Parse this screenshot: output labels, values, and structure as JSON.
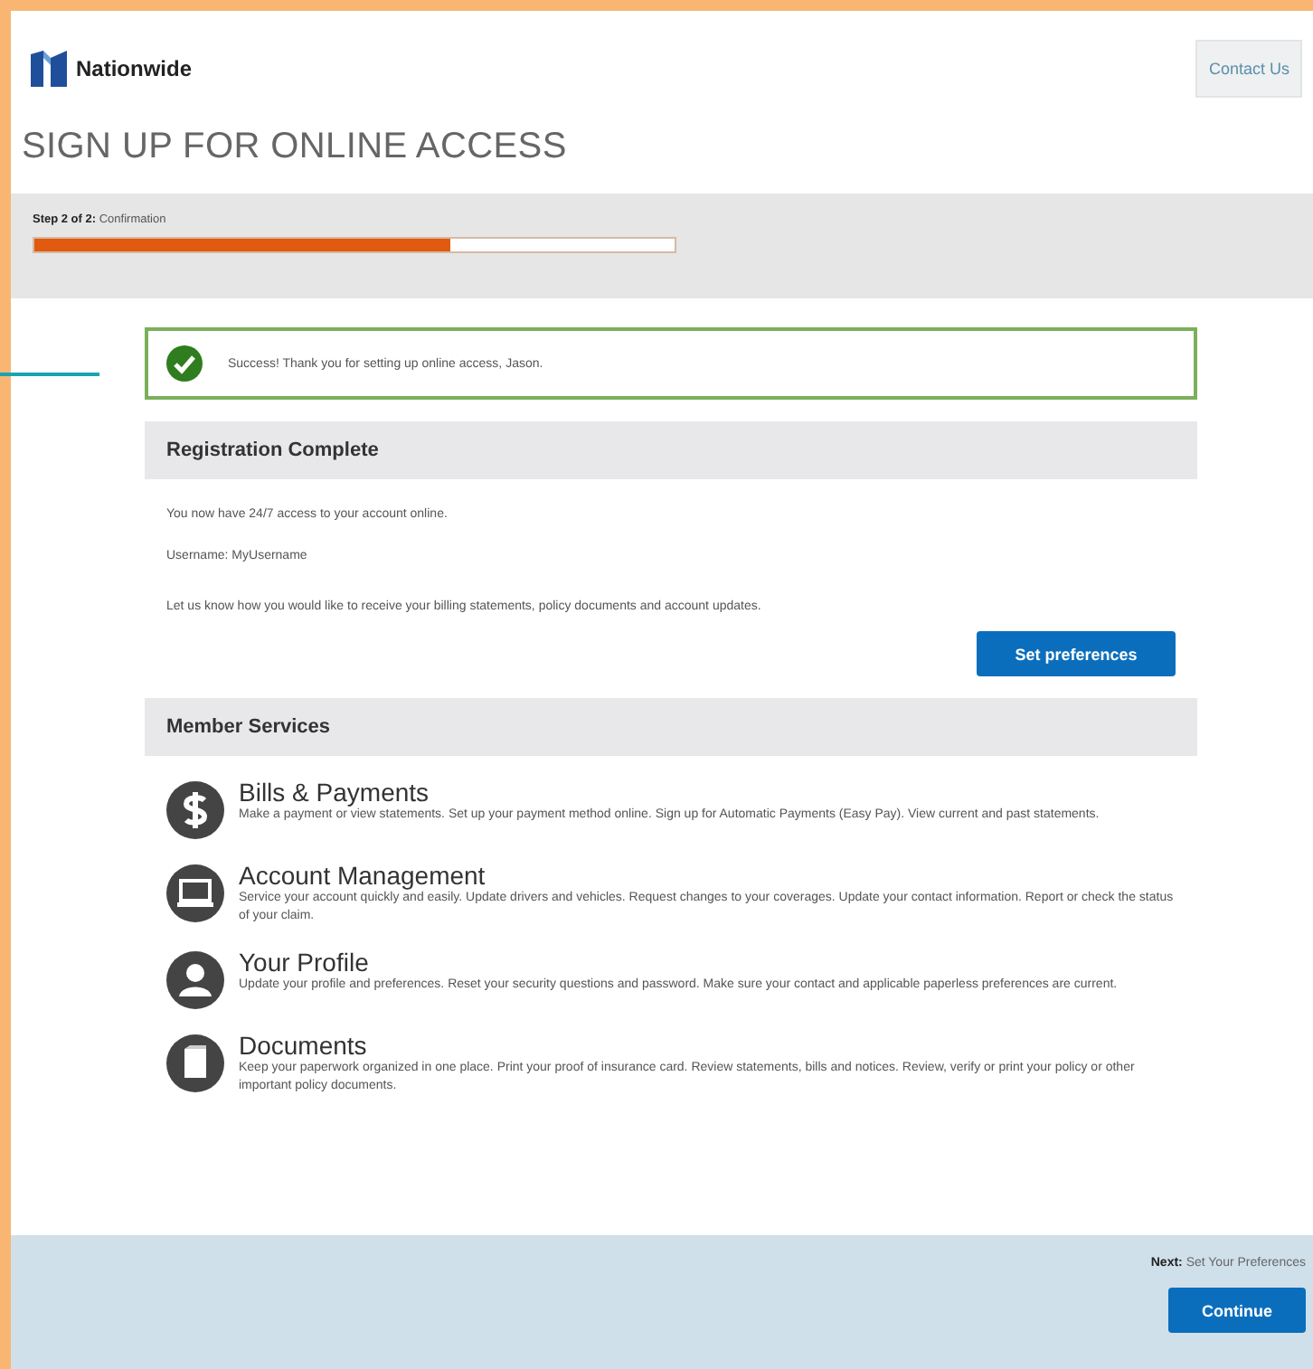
{
  "header": {
    "logo": "Nationwide",
    "contact_button": "Contact Us"
  },
  "page_title": "SIGN UP FOR ONLINE ACCESS",
  "progress": {
    "label": "**Step 2 of 2:** Confirmation",
    "level": 0.65
  },
  "alert": {
    "kind": "success",
    "message": "Success! Thank you for setting up online access, Jason."
  },
  "registration": {
    "heading": "Registration Complete",
    "lines": [
      "You now have 24/7 access to your account online.",
      "Username: MyUsername",
      "Let us know how you would like to receive your billing statements, policy documents and account updates."
    ],
    "button": "Set preferences"
  },
  "member_services": {
    "heading": "Member Services",
    "items": [
      {
        "kind": "dollar",
        "title": "Bills & Payments",
        "description": "Make a payment or view statements. Set up your payment method online. Sign up for Automatic Payments (Easy Pay). View current and past statements."
      },
      {
        "kind": "laptop",
        "title": "Account Management",
        "description": "Service your account quickly and easily. Update drivers and vehicles. Request changes to your coverages. Update your contact information. Report or check the status of your claim."
      },
      {
        "kind": "person",
        "title": "Your Profile",
        "description": "Update your profile and preferences. Reset your security questions and password. Make sure your contact and applicable paperless preferences are current."
      },
      {
        "kind": "document",
        "title": "Documents",
        "description": "Keep your paperwork organized in one place. Print your proof of insurance card. Review statements, bills and notices. Review, verify or print your policy or other important policy documents."
      }
    ]
  },
  "footer": {
    "next": "**Next:** Set Your Preferences",
    "button": "Continue"
  }
}
